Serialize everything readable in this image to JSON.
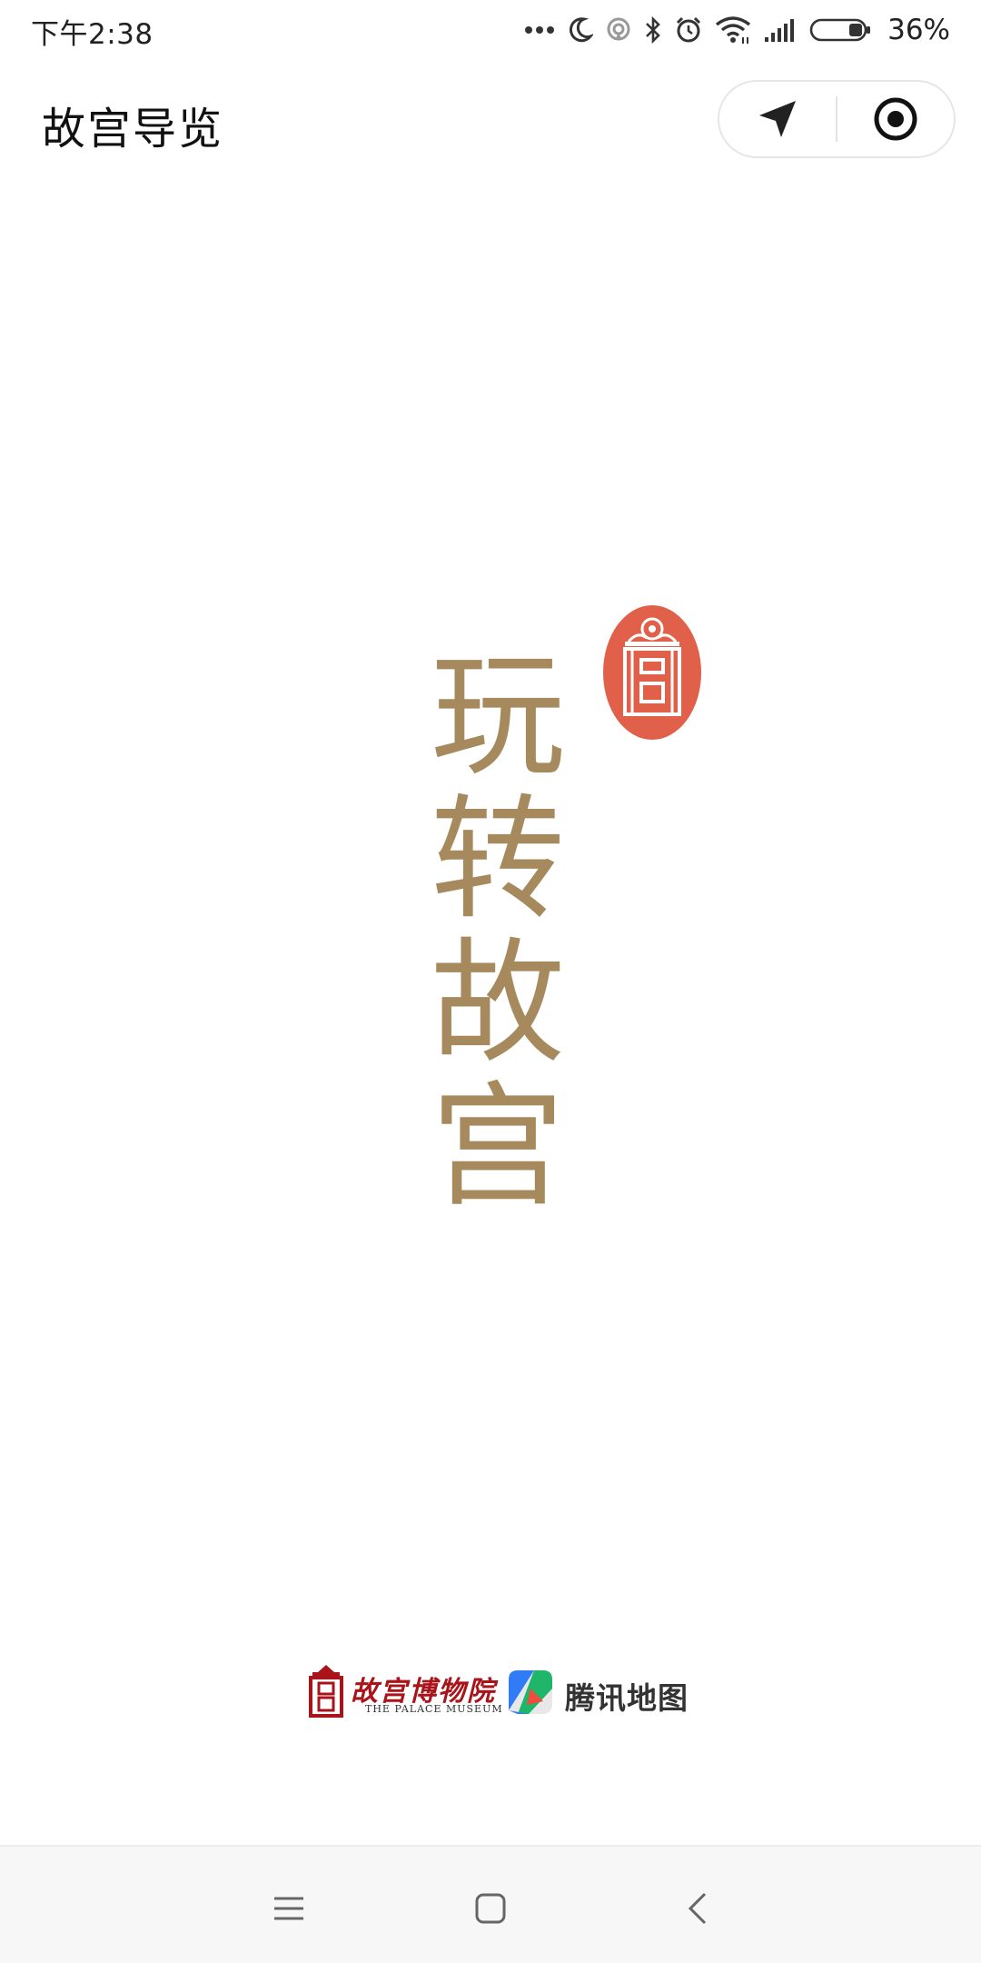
{
  "status_bar": {
    "time": "下午2:38",
    "battery": "36%",
    "icons": [
      "more-dots-icon",
      "moon-icon",
      "hotspot-icon",
      "bluetooth-icon",
      "alarm-icon",
      "wifi-icon",
      "signal-icon",
      "battery-icon"
    ]
  },
  "header": {
    "title": "故宫导览",
    "capsule_icons": [
      "navigation-arrow-icon",
      "target-icon"
    ]
  },
  "hero": {
    "chars": [
      "玩",
      "转",
      "故",
      "宫"
    ],
    "seal_char": "宫",
    "color": "#a68a5d",
    "seal_color": "#e0604a"
  },
  "footer": {
    "palace_museum_cn": "故宫博物院",
    "palace_museum_en": "THE PALACE MUSEUM",
    "tencent_map": "腾讯地图"
  },
  "nav": {
    "icons": [
      "menu-icon",
      "home-icon",
      "back-icon"
    ]
  }
}
